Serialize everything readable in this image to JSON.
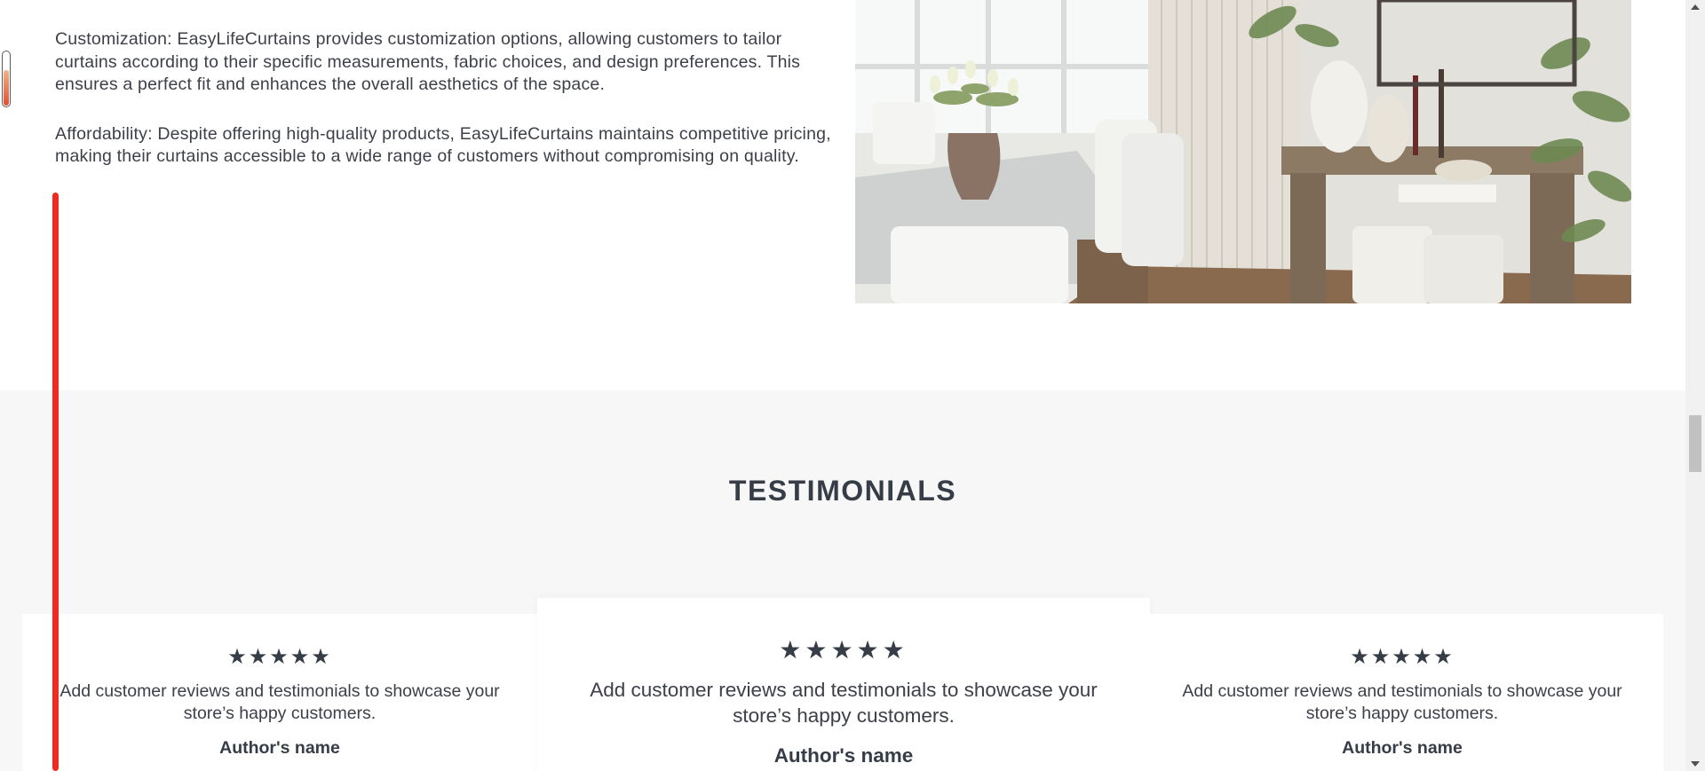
{
  "features": {
    "paragraphs": [
      "Customization: EasyLifeCurtains provides customization options, allowing customers to tailor curtains according to their specific measurements, fabric choices, and design preferences. This ensures a perfect fit and enhances the overall aesthetics of the space.",
      "Affordability: Despite offering high-quality products, EasyLifeCurtains maintains competitive pricing, making their curtains accessible to a wide range of customers without compromising on quality."
    ]
  },
  "image": {
    "description_icon": "room-photo"
  },
  "testimonials": {
    "title": "TESTIMONIALS",
    "cards": [
      {
        "stars": "★★★★★",
        "rating": 5,
        "text": "Add customer reviews and testimonials to showcase your store’s happy customers.",
        "author": "Author's name"
      },
      {
        "stars": "★★★★★",
        "rating": 5,
        "text": "Add customer reviews and testimonials to showcase your store’s happy customers.",
        "author": "Author's name"
      },
      {
        "stars": "★★★★★",
        "rating": 5,
        "text": "Add customer reviews and testimonials to showcase your store’s happy customers.",
        "author": "Author's name"
      }
    ]
  },
  "colors": {
    "text": "#3d4048",
    "heading": "#363d47",
    "section_bg": "#f7f7f7",
    "marker": "#ef2a20"
  }
}
